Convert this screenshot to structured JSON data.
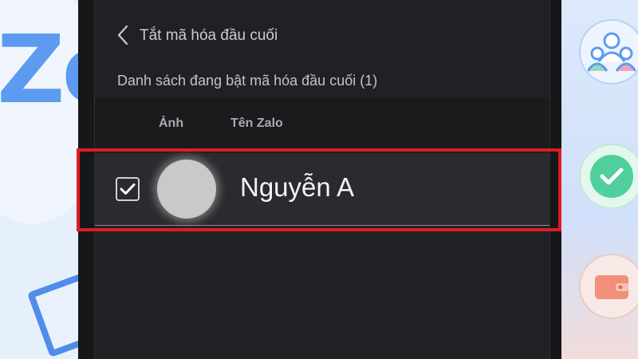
{
  "header": {
    "title": "Tắt mã hóa đầu cuối",
    "back_icon": "chevron-left-icon"
  },
  "subtitle": "Danh sách đang bật mã hóa đầu cuối (1)",
  "table": {
    "columns": [
      "Ảnh",
      "Tên Zalo"
    ],
    "rows": [
      {
        "checked": true,
        "avatar": "avatar-placeholder",
        "name": "Nguyễn A"
      }
    ]
  },
  "background": {
    "logo_text": "Zo",
    "decor_icons": [
      "people-icon",
      "check-circle-icon",
      "wallet-icon",
      "card-icon"
    ]
  },
  "colors": {
    "panel": "#202124",
    "highlight": "#e01b24",
    "check_green": "#4fcf9c",
    "brand_blue": "#5d9bf0"
  }
}
